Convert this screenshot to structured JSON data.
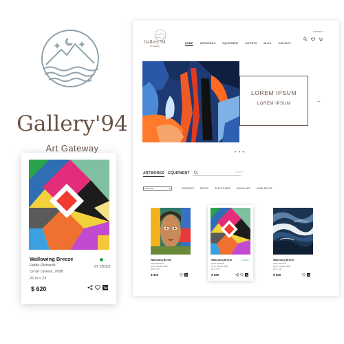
{
  "brand": {
    "name": "Gallery'94",
    "tagline": "Art Gateway",
    "colors": {
      "primary": "#6b5346",
      "logo_line": "#8fa2ad"
    }
  },
  "featured_card": {
    "title": "Wallowing Breeze",
    "artist": "Hettie Richards",
    "medium": "Oil on canvas, 2008",
    "size": "26 in × 23",
    "availability": "in stock",
    "price": "$ 620",
    "icons": [
      "share-icon",
      "heart-icon",
      "cart-icon"
    ]
  },
  "site": {
    "logo_name": "Gallery'94",
    "logo_tagline": "Art Gateway",
    "contact": "CONTACT",
    "nav": [
      {
        "label": "HOME",
        "active": true
      },
      {
        "label": "ARTWORKS",
        "active": false
      },
      {
        "label": "EQUIPMENT",
        "active": false
      },
      {
        "label": "ARTISTS",
        "active": false
      },
      {
        "label": "BLOG",
        "active": false
      },
      {
        "label": "CONTACT",
        "active": false
      }
    ],
    "header_icons": [
      "search-icon",
      "heart-icon",
      "cart-icon"
    ],
    "hero": {
      "title": "LOREM IPSUM",
      "subtitle": "LOREM IPSUM",
      "next_arrow": "→",
      "dots": "• • •"
    },
    "tabs": [
      {
        "label": "ARTWORKS",
        "active": true
      },
      {
        "label": "EQUIPMENT",
        "active": false
      }
    ],
    "search_placeholder": "SEARCH",
    "sort_label": "SORT BY",
    "filters": [
      "PAINTINGS",
      "PRINTS",
      "SCULPTURES",
      "DIGITAL ART",
      "HOME DECOR"
    ],
    "products": [
      {
        "title": "Wallowing Breeze",
        "artist": "Hettie Richards",
        "medium": "Oil on canvas, 2008",
        "size": "26 in × 23",
        "price": "$ 620",
        "in_stock": false
      },
      {
        "title": "Wallowing Breeze",
        "artist": "Hettie Richards",
        "medium": "Oil on canvas, 2008",
        "size": "26 in × 23",
        "price": "$ 620",
        "in_stock": true,
        "stock_label": "in stock"
      },
      {
        "title": "Wallowing Breeze",
        "artist": "Hettie Richards",
        "medium": "Oil on canvas, 2008",
        "size": "26 in × 23",
        "price": "$ 620",
        "in_stock": false
      }
    ]
  }
}
